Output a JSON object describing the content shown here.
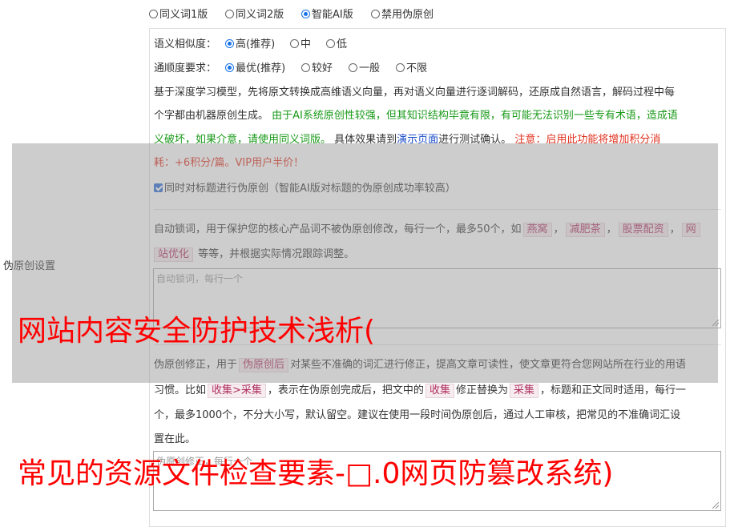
{
  "version_options": [
    {
      "label": "同义词1版",
      "checked": false
    },
    {
      "label": "同义词2版",
      "checked": false
    },
    {
      "label": "智能AI版",
      "checked": true
    },
    {
      "label": "禁用伪原创",
      "checked": false
    }
  ],
  "side_label": "伪原创设置",
  "similarity": {
    "label": "语义相似度：",
    "options": [
      {
        "label": "高(推荐)",
        "checked": true
      },
      {
        "label": "中",
        "checked": false
      },
      {
        "label": "低",
        "checked": false
      }
    ]
  },
  "fluency": {
    "label": "通顺度要求：",
    "options": [
      {
        "label": "最优(推荐)",
        "checked": true
      },
      {
        "label": "较好",
        "checked": false
      },
      {
        "label": "一般",
        "checked": false
      },
      {
        "label": "不限",
        "checked": false
      }
    ]
  },
  "description": {
    "line1": "基于深度学习模型，先将原文转换成高维语义向量，再对语义向量进行逐词解码，还原成自然语言，解码过程中每",
    "line2_plain": "个字都由机器原创生成。 ",
    "line2_green": "由于AI系统原创性较强，但其知识结构毕竟有限，有可能无法识别一些专有术语，造成语",
    "line3_green": "义破坏，如果介意，请使用同义词版。",
    "line3_plain1": " 具体效果请到",
    "line3_link": "演示页面",
    "line3_plain2": "进行测试确认。 ",
    "line3_red": "注意：启用此功能将增加积分消",
    "line4_red": "耗：+6积分/篇。VIP用户半价！"
  },
  "title_checkbox": {
    "label": "同时对标题进行伪原创（智能AI版对标题的伪原创成功率较高）",
    "checked": true
  },
  "lock_words": {
    "text1": "自动锁词，用于保护您的核心产品词不被伪原创修改，每行一个，最多50个，如",
    "tags": [
      "燕窝",
      "减肥茶",
      "股票配资",
      "网"
    ],
    "tag_cont": "站优化",
    "text2": "等等，并根据实际情况跟踪调整。",
    "placeholder": "自动锁词，每行一个"
  },
  "correction": {
    "line1a": "伪原创修正，用于",
    "line1_tag": "伪原创后",
    "line1b": "对某些不准确的词汇进行修正，提高文章可读性，使文章更符合您网站所在行业的用语",
    "line2a": "习惯。比如",
    "line2_tag1": "收集>采集",
    "line2b": "，表示在伪原创完成后，把文中的",
    "line2_tag2": "收集",
    "line2c": "修正替换为",
    "line2_tag3": "采集",
    "line2d": "，标题和正文同时适用，每行一",
    "line3": "个，最多1000个，不分大小写，默认留空。建议在使用一段时间伪原创后，通过人工审核，把常见的不准确词汇设",
    "line4": "置在此。",
    "placeholder": "伪原创修正，每行一个"
  },
  "watermark": {
    "line1": "网站内容安全防护技术浅析(",
    "line2": "常见的资源文件检查要素-□.0网页防篡改系统)",
    "color": "#ff0000"
  }
}
